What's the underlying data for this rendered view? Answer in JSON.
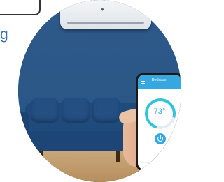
{
  "page": {
    "side_text": "g"
  },
  "phone": {
    "app_title": "Bedroom",
    "days": [
      "",
      "",
      "",
      "",
      ""
    ],
    "temperature": "73°",
    "dial_subtitle": ""
  },
  "colors": {
    "wall": "#2e5a8a",
    "accent": "#37a7e0",
    "couch": "#1f4a7c"
  }
}
